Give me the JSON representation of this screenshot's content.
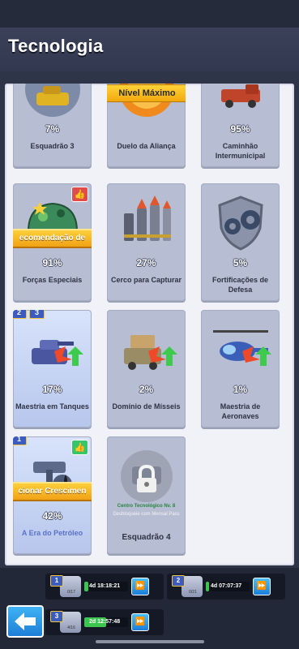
{
  "title": "Tecnologia",
  "cards": [
    {
      "id": "esquadrao-3",
      "percent": "7%",
      "name": "Esquadrão 3"
    },
    {
      "id": "duelo",
      "percent": "",
      "name": "Duelo da Aliança",
      "badge": "Nível Máximo"
    },
    {
      "id": "caminhao",
      "percent": "95%",
      "name": "Caminhão Intermunicipal"
    },
    {
      "id": "forcas",
      "percent": "91%",
      "name": "Forças Especiais",
      "ribbon": "ecomendação de"
    },
    {
      "id": "cerco",
      "percent": "27%",
      "name": "Cerco para Capturar"
    },
    {
      "id": "fortificacoes",
      "percent": "5%",
      "name": "Fortificações de Defesa"
    },
    {
      "id": "tanques",
      "percent": "17%",
      "name": "Maestria em Tanques",
      "levels": [
        "2",
        "3"
      ]
    },
    {
      "id": "misseis",
      "percent": "2%",
      "name": "Domínio de Mísseis"
    },
    {
      "id": "aeronaves",
      "percent": "1%",
      "name": "Maestria de Aeronaves"
    },
    {
      "id": "petroleo",
      "percent": "42%",
      "name": "A Era do Petróleo",
      "levels": [
        "1"
      ],
      "ribbon": "cionar Crescimen"
    },
    {
      "id": "esquadrao-4",
      "name": "Esquadrão 4",
      "lock_title": "Centro Tecnológico Nv. 8",
      "lock_sub": "Desbloqueie com Mensal Pass"
    }
  ],
  "queue": [
    {
      "level": "1",
      "count": "0/17",
      "time": "4d 18:18:21",
      "progress": 0.1
    },
    {
      "level": "2",
      "count": "0/21",
      "time": "4d 07:07:37",
      "progress": 0.08
    },
    {
      "level": "3",
      "count": "4/16",
      "time": "2d 12:57:48",
      "progress": 0.5
    }
  ],
  "colors": {
    "accent": "#1d7fd6",
    "progress": "#3dc64f",
    "badge": "#f2a80f"
  }
}
